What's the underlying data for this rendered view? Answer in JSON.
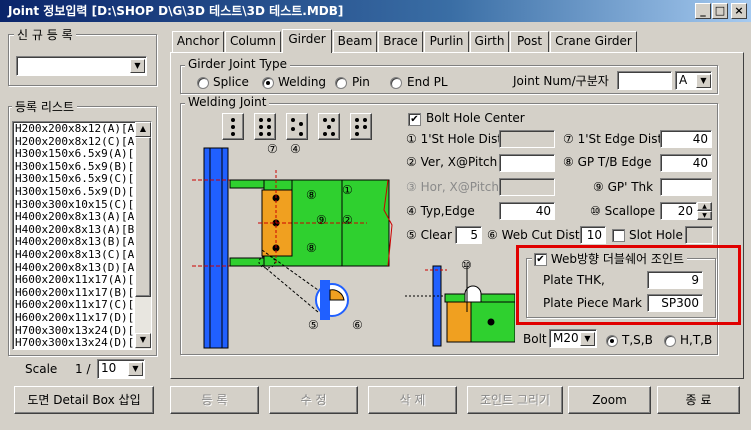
{
  "window": {
    "title": "Joint 정보입력  [D:\\SHOP D\\G\\3D 테스트\\3D 테스트.MDB]",
    "controls": [
      "_",
      "□",
      "×"
    ]
  },
  "left_panel": {
    "new_reg_label": "신 규 등 록",
    "new_reg_value": "",
    "reg_list_label": "등록 리스트",
    "reg_list": [
      "H200x200x8x12(A)[A]",
      "H200x200x8x12(C)[A]",
      "H300x150x6.5x9(A)[A",
      "H300x150x6.5x9(B)[A",
      "H300x150x6.5x9(C)[A",
      "H300x150x6.5x9(D)[A",
      "H300x300x10x15(C)[A",
      "H400x200x8x13(A)[A]",
      "H400x200x8x13(A)[B]",
      "H400x200x8x13(B)[A]",
      "H400x200x8x13(C)[A]",
      "H400x200x8x13(D)[A]",
      "H600x200x11x17(A)[A",
      "H600x200x11x17(B)[A",
      "H600x200x11x17(C)[A",
      "H600x200x11x17(D)[A",
      "H700x300x13x24(D)[A",
      "H700x300x13x24(D)[B"
    ],
    "scale_label": "Scale",
    "scale_prefix": "1 /",
    "scale_value": "10",
    "detail_box_button": "도면 Detail Box 삽입"
  },
  "tabs": [
    {
      "label": "Anchor"
    },
    {
      "label": "Column"
    },
    {
      "label": "Girder"
    },
    {
      "label": "Beam"
    },
    {
      "label": "Brace"
    },
    {
      "label": "Purlin"
    },
    {
      "label": "Girth"
    },
    {
      "label": "Post"
    },
    {
      "label": "Crane Girder"
    }
  ],
  "active_tab": "Girder",
  "girder_joint_type": {
    "label": "Girder Joint Type",
    "options": [
      {
        "label": "Splice",
        "selected": false
      },
      {
        "label": "Welding",
        "selected": true
      },
      {
        "label": "Pin",
        "selected": false
      },
      {
        "label": "End PL",
        "selected": false
      }
    ],
    "joint_num_label": "Joint Num/구분자",
    "joint_num_value": "",
    "separator_value": "A"
  },
  "welding_joint": {
    "label": "Welding Joint",
    "bolt_hole_center_label": "Bolt Hole Center",
    "bolt_hole_center_checked": true,
    "fields": {
      "st_hole_dist": {
        "label": "① 1'St Hole Dist",
        "value": ""
      },
      "st_edge_dist": {
        "label": "⑦ 1'St Edge Dist",
        "value": "40"
      },
      "ver_pitch": {
        "label": "② Ver, X@Pitch",
        "value": ""
      },
      "gp_tb_edge": {
        "label": "⑧ GP T/B Edge",
        "value": "40"
      },
      "hor_pitch": {
        "label": "③ Hor, X@Pitch",
        "value": ""
      },
      "gp_thk": {
        "label": "⑨ GP' Thk",
        "value": ""
      },
      "typ_edge": {
        "label": "④ Typ,Edge",
        "value": "40"
      },
      "scallope": {
        "label": "⑩ Scallope",
        "value": "20"
      },
      "clear": {
        "label": "⑤ Clear",
        "value": "5"
      },
      "web_cut_dist": {
        "label": "⑥ Web Cut Dist",
        "value": "10"
      }
    },
    "slot_hole_label": "Slot Hole",
    "slot_hole_checked": false,
    "slot_hole_value": "",
    "web_double_shear_label": "Web방향 더블쉐어 조인트",
    "web_double_shear_checked": true,
    "plate_thk_label": "Plate THK,",
    "plate_thk_value": "9",
    "plate_piece_mark_label": "Plate Piece Mark",
    "plate_piece_mark_value": "SP300",
    "bolt_label": "Bolt",
    "bolt_value": "M20",
    "bolt_type_options": [
      {
        "label": "T,S,B",
        "selected": true
      },
      {
        "label": "H,T,B",
        "selected": false
      }
    ],
    "drawing_numbers": [
      "①",
      "②",
      "④",
      "⑤",
      "⑥",
      "⑦",
      "⑧",
      "⑨",
      "⑧",
      "⑩"
    ]
  },
  "bottom_buttons": [
    {
      "label": "등 록",
      "enabled": false
    },
    {
      "label": "수 정",
      "enabled": false
    },
    {
      "label": "삭 제",
      "enabled": false
    },
    {
      "label": "조인트 그리기",
      "enabled": false
    },
    {
      "label": "Zoom",
      "enabled": true
    },
    {
      "label": "종 료",
      "enabled": true
    }
  ],
  "colors": {
    "title_start": "#0a246a",
    "title_end": "#a6caf0",
    "highlight_box": "#e00000",
    "green_plate": "#2fd02f",
    "orange_plate": "#f0a020",
    "blue_column": "#2060ff",
    "drawing_bg": "#d4d0c8"
  }
}
